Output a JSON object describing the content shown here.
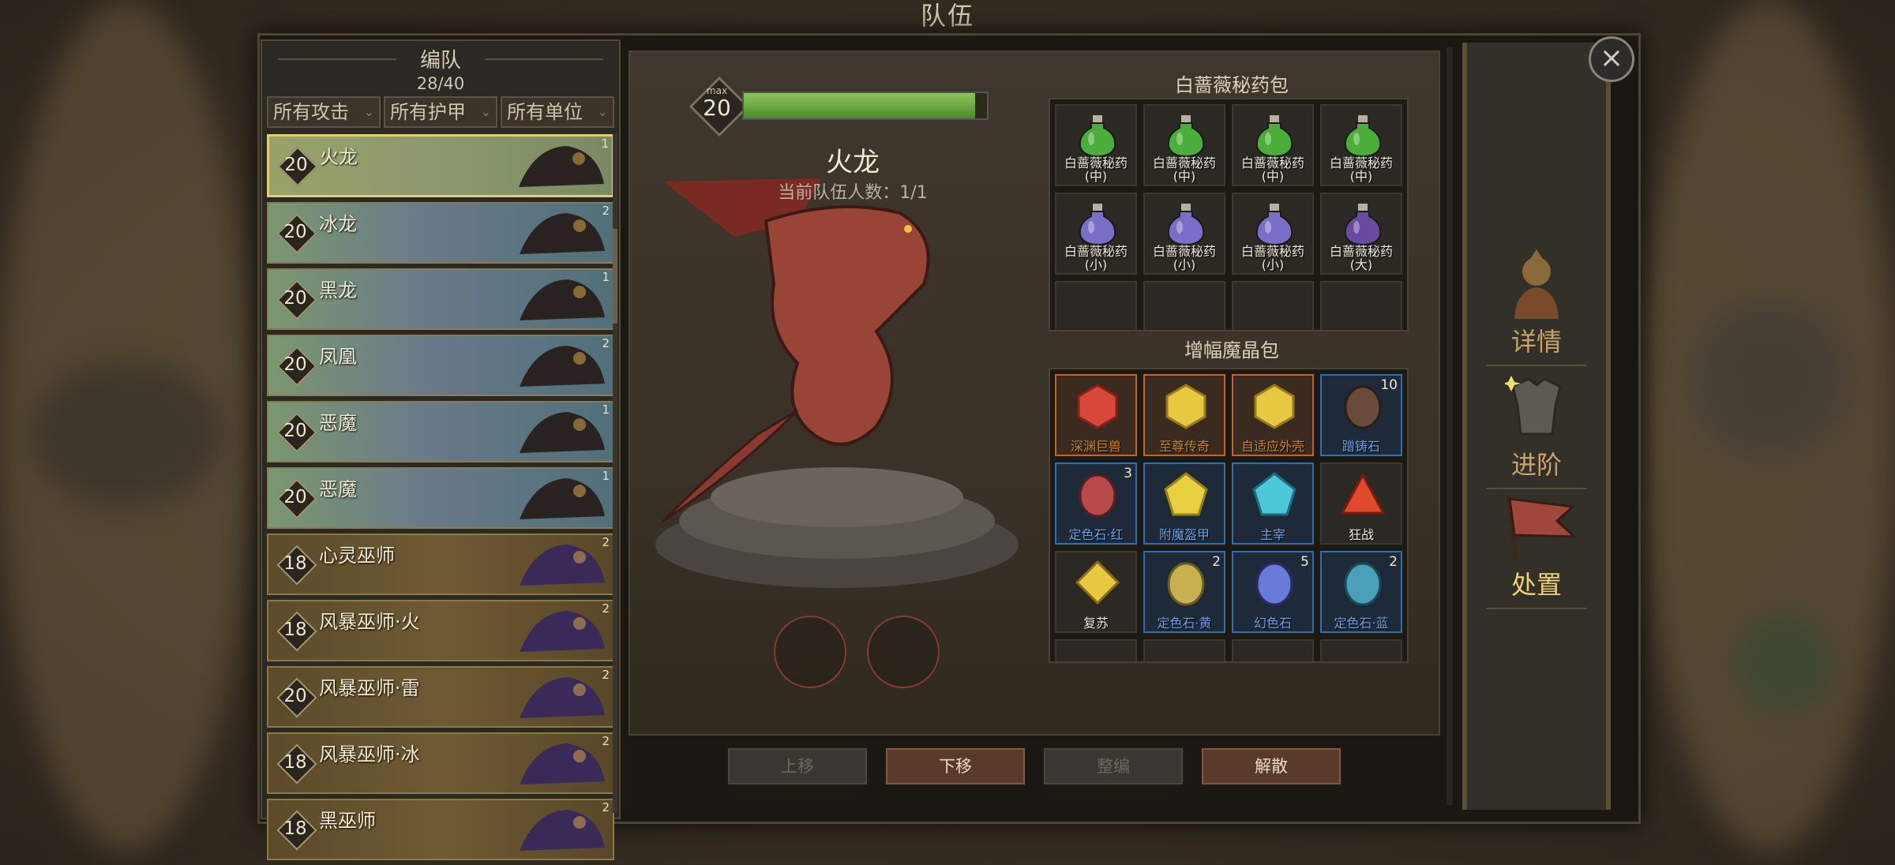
{
  "page_title": "队伍",
  "roster": {
    "title": "编队",
    "count": "28/40",
    "filters": [
      "所有攻击",
      "所有护甲",
      "所有单位"
    ],
    "units": [
      {
        "level": "20",
        "name": "火龙",
        "count": "1",
        "kind": "dragon",
        "selected": true
      },
      {
        "level": "20",
        "name": "冰龙",
        "count": "2",
        "kind": "dragon"
      },
      {
        "level": "20",
        "name": "黑龙",
        "count": "1",
        "kind": "dragon"
      },
      {
        "level": "20",
        "name": "凤凰",
        "count": "2",
        "kind": "dragon"
      },
      {
        "level": "20",
        "name": "恶魔",
        "count": "1",
        "kind": "dragon"
      },
      {
        "level": "20",
        "name": "恶魔",
        "count": "1",
        "kind": "dragon"
      },
      {
        "level": "18",
        "name": "心灵巫师",
        "count": "2",
        "kind": "mage"
      },
      {
        "level": "18",
        "name": "风暴巫师·火",
        "count": "2",
        "kind": "mage"
      },
      {
        "level": "20",
        "name": "风暴巫师·雷",
        "count": "2",
        "kind": "mage"
      },
      {
        "level": "18",
        "name": "风暴巫师·冰",
        "count": "2",
        "kind": "mage"
      },
      {
        "level": "18",
        "name": "黑巫师",
        "count": "2",
        "kind": "mage"
      }
    ]
  },
  "detail": {
    "max_label": "max",
    "max_level": "20",
    "xp_fraction": 0.95,
    "unit_name": "火龙",
    "team_count": "当前队伍人数：1/1",
    "buttons": {
      "up": "上移",
      "down": "下移",
      "reorg": "整编",
      "disband": "解散"
    }
  },
  "potions": {
    "title": "白蔷薇秘药包",
    "items": [
      {
        "name": "白蔷薇秘药\n(中)",
        "color": "#4cae3a"
      },
      {
        "name": "白蔷薇秘药\n(中)",
        "color": "#4cae3a"
      },
      {
        "name": "白蔷薇秘药\n(中)",
        "color": "#4cae3a"
      },
      {
        "name": "白蔷薇秘药\n(中)",
        "color": "#4cae3a"
      },
      {
        "name": "白蔷薇秘药\n(小)",
        "color": "#7a6ec8"
      },
      {
        "name": "白蔷薇秘药\n(小)",
        "color": "#7a6ec8"
      },
      {
        "name": "白蔷薇秘药\n(小)",
        "color": "#7a6ec8"
      },
      {
        "name": "白蔷薇秘药\n(大)",
        "color": "#6a4aa0"
      }
    ]
  },
  "crystals": {
    "title": "增幅魔晶包",
    "items": [
      {
        "name": "深渊巨兽",
        "frame": "orange",
        "gem": "red",
        "qty": ""
      },
      {
        "name": "至尊传奇",
        "frame": "orange",
        "gem": "gold",
        "qty": ""
      },
      {
        "name": "自适应外壳",
        "frame": "orange",
        "gem": "gold",
        "qty": ""
      },
      {
        "name": "蹭铸石",
        "frame": "blue",
        "gem": "ore",
        "qty": "10"
      },
      {
        "name": "定色石·红",
        "frame": "blue",
        "gem": "redstone",
        "qty": "3"
      },
      {
        "name": "附魔盔甲",
        "frame": "blue",
        "gem": "goldpent",
        "qty": ""
      },
      {
        "name": "主宰",
        "frame": "blue",
        "gem": "cyan",
        "qty": ""
      },
      {
        "name": "狂战",
        "frame": "plain",
        "gem": "redtri",
        "qty": ""
      },
      {
        "name": "复苏",
        "frame": "plain",
        "gem": "golddiamond",
        "qty": ""
      },
      {
        "name": "定色石·黄",
        "frame": "blue",
        "gem": "yellowstone",
        "qty": "2"
      },
      {
        "name": "幻色石",
        "frame": "blue",
        "gem": "bluestone",
        "qty": "5"
      },
      {
        "name": "定色石·蓝",
        "frame": "blue",
        "gem": "cyanstone",
        "qty": "2"
      }
    ]
  },
  "side_menu": [
    {
      "label": "详情",
      "icon": "knight-icon",
      "active": false
    },
    {
      "label": "进阶",
      "icon": "armor-icon",
      "active": false
    },
    {
      "label": "处置",
      "icon": "flag-icon",
      "active": true
    }
  ],
  "close_label": "×"
}
